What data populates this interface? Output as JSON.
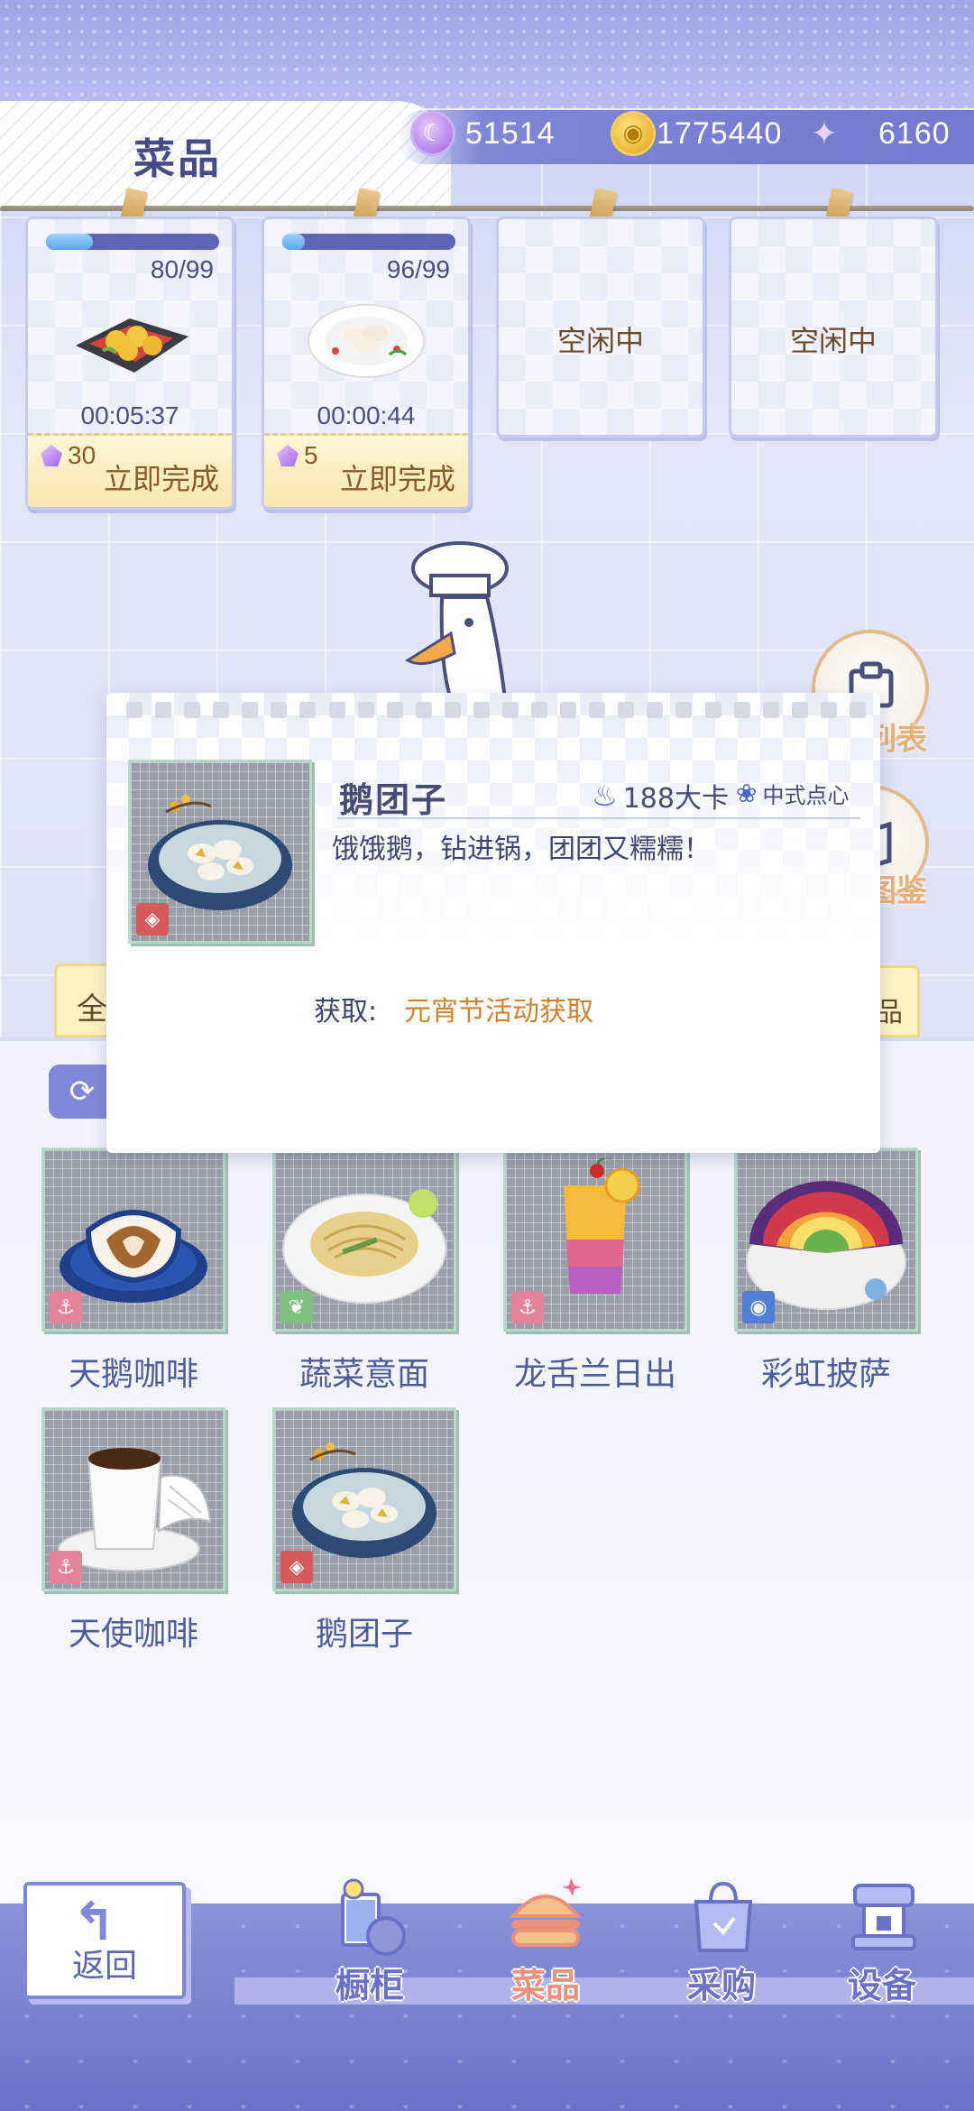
{
  "header": {
    "title": "菜品",
    "currencies": [
      {
        "icon": "moon-coin-icon",
        "value": "51514"
      },
      {
        "icon": "gold-coin-icon",
        "value": "1775440"
      },
      {
        "icon": "swan-plus-icon",
        "value": "6160"
      }
    ]
  },
  "ovens": [
    {
      "state": "cooking",
      "progress": 0.27,
      "count": "80/99",
      "dish_icon": "shrimp-dish-icon",
      "timer": "00:05:37",
      "cost": "30",
      "finish_label": "立即完成"
    },
    {
      "state": "cooking",
      "progress": 0.13,
      "count": "96/99",
      "dish_icon": "dumpling-plate-icon",
      "timer": "00:00:44",
      "cost": "5",
      "finish_label": "立即完成"
    },
    {
      "state": "idle",
      "idle_label": "空闲中"
    },
    {
      "state": "idle",
      "idle_label": "空闲中"
    }
  ],
  "side_buttons": [
    {
      "label": "列表",
      "icon": "list-icon"
    },
    {
      "label": "图鉴",
      "icon": "collection-icon"
    }
  ],
  "tabs": {
    "left": "全",
    "right": "品"
  },
  "popup": {
    "name": "鹅团子",
    "calories": "188大卡",
    "type": "中式点心",
    "description": "饿饿鹅，钻进锅，团团又糯糯！",
    "obtain_label": "获取:",
    "obtain_value": "元宵节活动获取"
  },
  "dishes": [
    {
      "name": "天鹅咖啡",
      "badge": "anchor-icon",
      "badge_color": "#e68497"
    },
    {
      "name": "蔬菜意面",
      "badge": "leaf-icon",
      "badge_color": "#7fbf7f"
    },
    {
      "name": "龙舌兰日出",
      "badge": "anchor-icon",
      "badge_color": "#e68497"
    },
    {
      "name": "彩虹披萨",
      "badge": "bulb-icon",
      "badge_color": "#4f7fd6"
    },
    {
      "name": "天使咖啡",
      "badge": "anchor-icon",
      "badge_color": "#e68497"
    },
    {
      "name": "鹅团子",
      "badge": "lantern-icon",
      "badge_color": "#d65a5a"
    }
  ],
  "bottom_nav": {
    "back_label": "返回",
    "items": [
      {
        "label": "橱柜",
        "icon": "cabinet-icon",
        "active": false
      },
      {
        "label": "菜品",
        "icon": "burger-icon",
        "active": true
      },
      {
        "label": "采购",
        "icon": "shopping-bag-icon",
        "active": false
      },
      {
        "label": "设备",
        "icon": "coffee-machine-icon",
        "active": false
      }
    ]
  }
}
